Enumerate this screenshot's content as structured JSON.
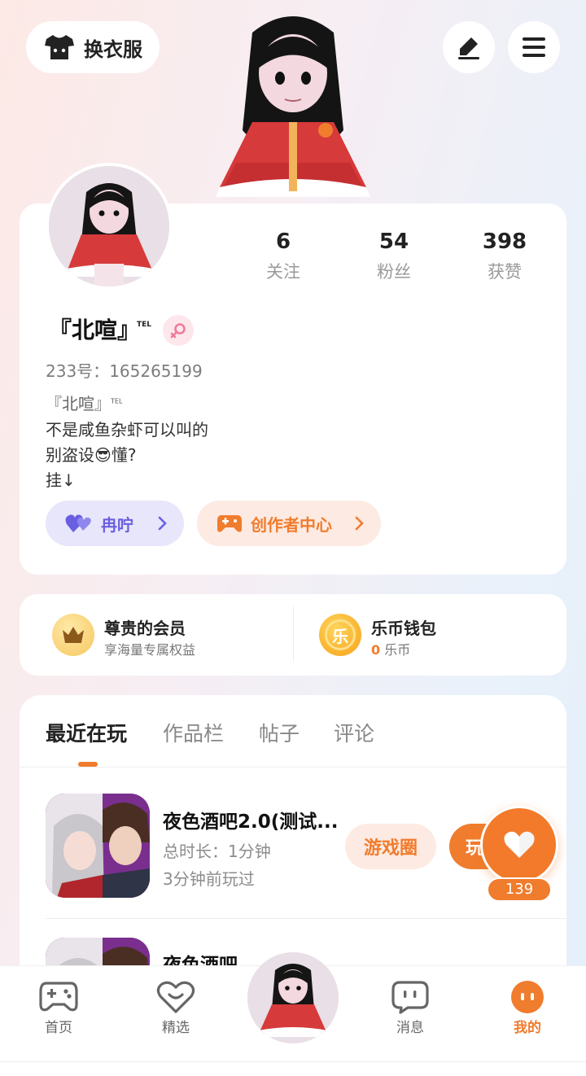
{
  "top_bar": {
    "dress_label": "换衣服",
    "edit_icon": "pen-icon",
    "menu_icon": "hamburger-icon"
  },
  "profile": {
    "stats": [
      {
        "value": "6",
        "label": "关注"
      },
      {
        "value": "54",
        "label": "粉丝"
      },
      {
        "value": "398",
        "label": "获赞"
      }
    ],
    "name": "『北喧』",
    "name_tag": "TEL",
    "gender": "female",
    "uid_label": "233号：",
    "uid": "165265199",
    "bio_lines": [
      "『北喧』",
      "不是咸鱼杂虾可以叫的",
      " 别盗设😎懂?",
      "挂↓"
    ],
    "bio_tag": "TEL",
    "pill_cp": "冉咛",
    "pill_creator": "创作者中心"
  },
  "member": {
    "vip_title": "尊贵的会员",
    "vip_sub": "享海量专属权益",
    "wallet_title": "乐币钱包",
    "wallet_coin_glyph": "乐",
    "wallet_amount": "0",
    "wallet_unit": "乐币"
  },
  "tabs": [
    "最近在玩",
    "作品栏",
    "帖子",
    "评论"
  ],
  "games": [
    {
      "title": "夜色酒吧2.0(测试...",
      "duration": "总时长：1分钟",
      "last_played": "3分钟前玩过",
      "circle_label": "游戏圈",
      "play_label": "玩"
    },
    {
      "title": "夜色酒吧"
    }
  ],
  "like": {
    "count": "139"
  },
  "bottom_nav": [
    {
      "label": "首页",
      "icon": "gamepad-icon"
    },
    {
      "label": "精选",
      "icon": "heart-smile-icon"
    },
    {
      "label": "消息",
      "icon": "chat-icon"
    },
    {
      "label": "我的",
      "icon": "profile-icon"
    }
  ],
  "colors": {
    "accent": "#f07c2d",
    "purple": "#6a5fe0"
  }
}
